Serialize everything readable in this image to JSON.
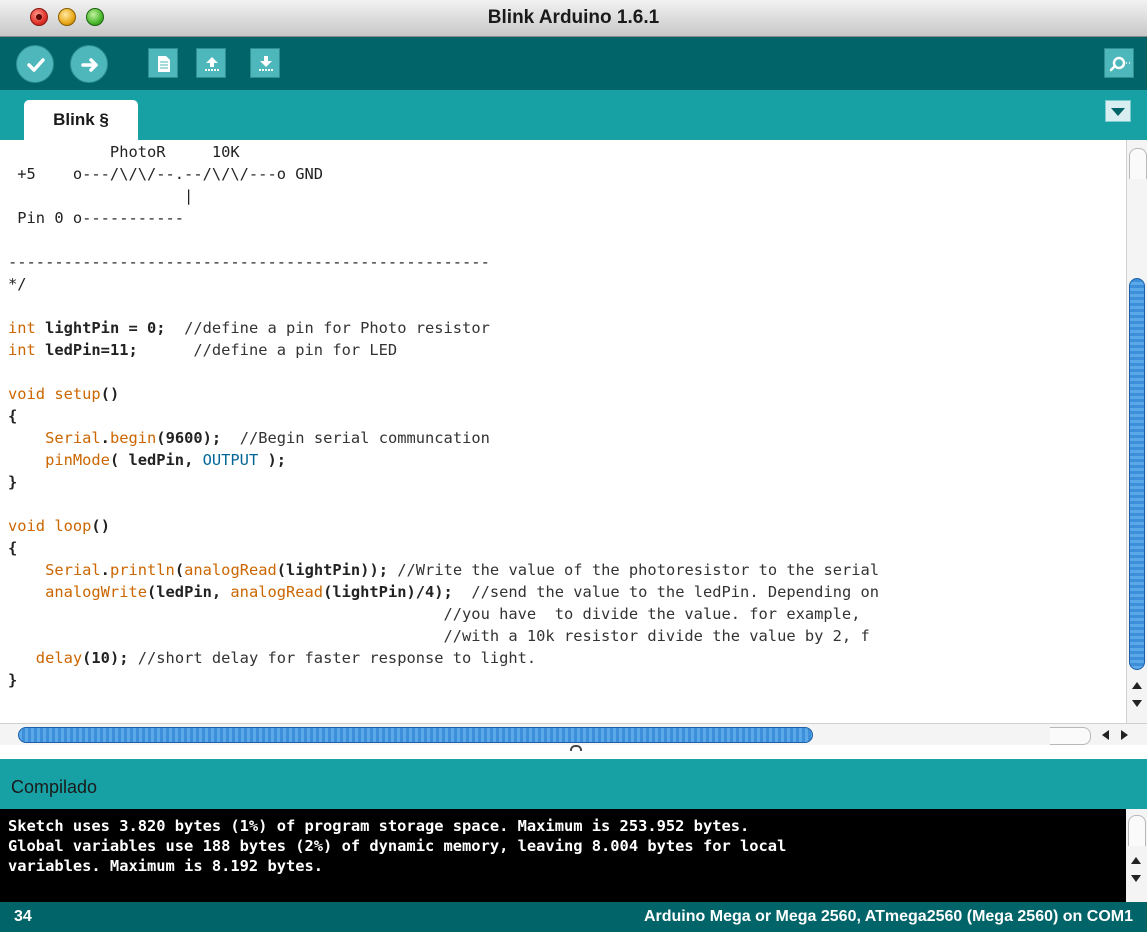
{
  "window": {
    "title": "Blink Arduino 1.6.1"
  },
  "toolbar": {
    "buttons": [
      {
        "icon": "checkmark-icon",
        "action": "verify"
      },
      {
        "icon": "arrow-right-icon",
        "action": "upload"
      },
      {
        "icon": "new-document-icon",
        "action": "new"
      },
      {
        "icon": "open-arrow-up-icon",
        "action": "open"
      },
      {
        "icon": "save-arrow-down-icon",
        "action": "save"
      }
    ],
    "monitor_icon": "magnifier-icon"
  },
  "tabs": [
    {
      "label": "Blink §",
      "active": true
    }
  ],
  "editor": {
    "lines": {
      "l1": "           PhotoR     10K",
      "l2": " +5    o---/\\/\\/--.--/\\/\\/---o GND",
      "l3": "                   |",
      "l4": " Pin 0 o-----------",
      "l5": "",
      "l6": "----------------------------------------------------",
      "l7": "*/",
      "l8": "",
      "l9a": "int",
      "l9b": " lightPin = 0;",
      "l9c": "  //define a pin for Photo resistor",
      "l10a": "int",
      "l10b": " ledPin=11;",
      "l10c": "      //define a pin for LED",
      "l11": "",
      "l12a": "void",
      "l12b": " setup",
      "l12c": "()",
      "l13": "{",
      "l14a": "    Serial",
      "l14b": ".",
      "l14c": "begin",
      "l14d": "(9600);",
      "l14e": "  //Begin serial communcation",
      "l15a": "    pinMode",
      "l15b": "( ledPin, ",
      "l15c": "OUTPUT",
      "l15d": " );",
      "l16": "}",
      "l17": "",
      "l18a": "void",
      "l18b": " loop",
      "l18c": "()",
      "l19": "{",
      "l20a": "    Serial",
      "l20b": ".",
      "l20c": "println",
      "l20d": "(",
      "l20e": "analogRead",
      "l20f": "(lightPin));",
      "l20g": " //Write the value of the photoresistor to the serial",
      "l21a": "    analogWrite",
      "l21b": "(ledPin, ",
      "l21c": "analogRead",
      "l21d": "(lightPin)/4);",
      "l21e": "  //send the value to the ledPin. Depending on",
      "l22": "                                               //you have  to divide the value. for example,",
      "l23": "                                               //with a 10k resistor divide the value by 2, f",
      "l24a": "   delay",
      "l24b": "(10);",
      "l24c": " //short delay for faster response to light.",
      "l25": "}"
    }
  },
  "console": {
    "header": "Compilado",
    "output": "Sketch uses 3.820 bytes (1%) of program storage space. Maximum is 253.952 bytes.\nGlobal variables use 188 bytes (2%) of dynamic memory, leaving 8.004 bytes for local\nvariables. Maximum is 8.192 bytes."
  },
  "status": {
    "line_number": "34",
    "board": "Arduino Mega or Mega 2560, ATmega2560 (Mega 2560) on COM1"
  },
  "colors": {
    "toolbar_bg": "#006468",
    "tabbar_bg": "#17a1a5",
    "button_bg": "#4db7bb",
    "keyword": "#cc6600",
    "literal": "#006699",
    "console_bg": "#000000"
  }
}
